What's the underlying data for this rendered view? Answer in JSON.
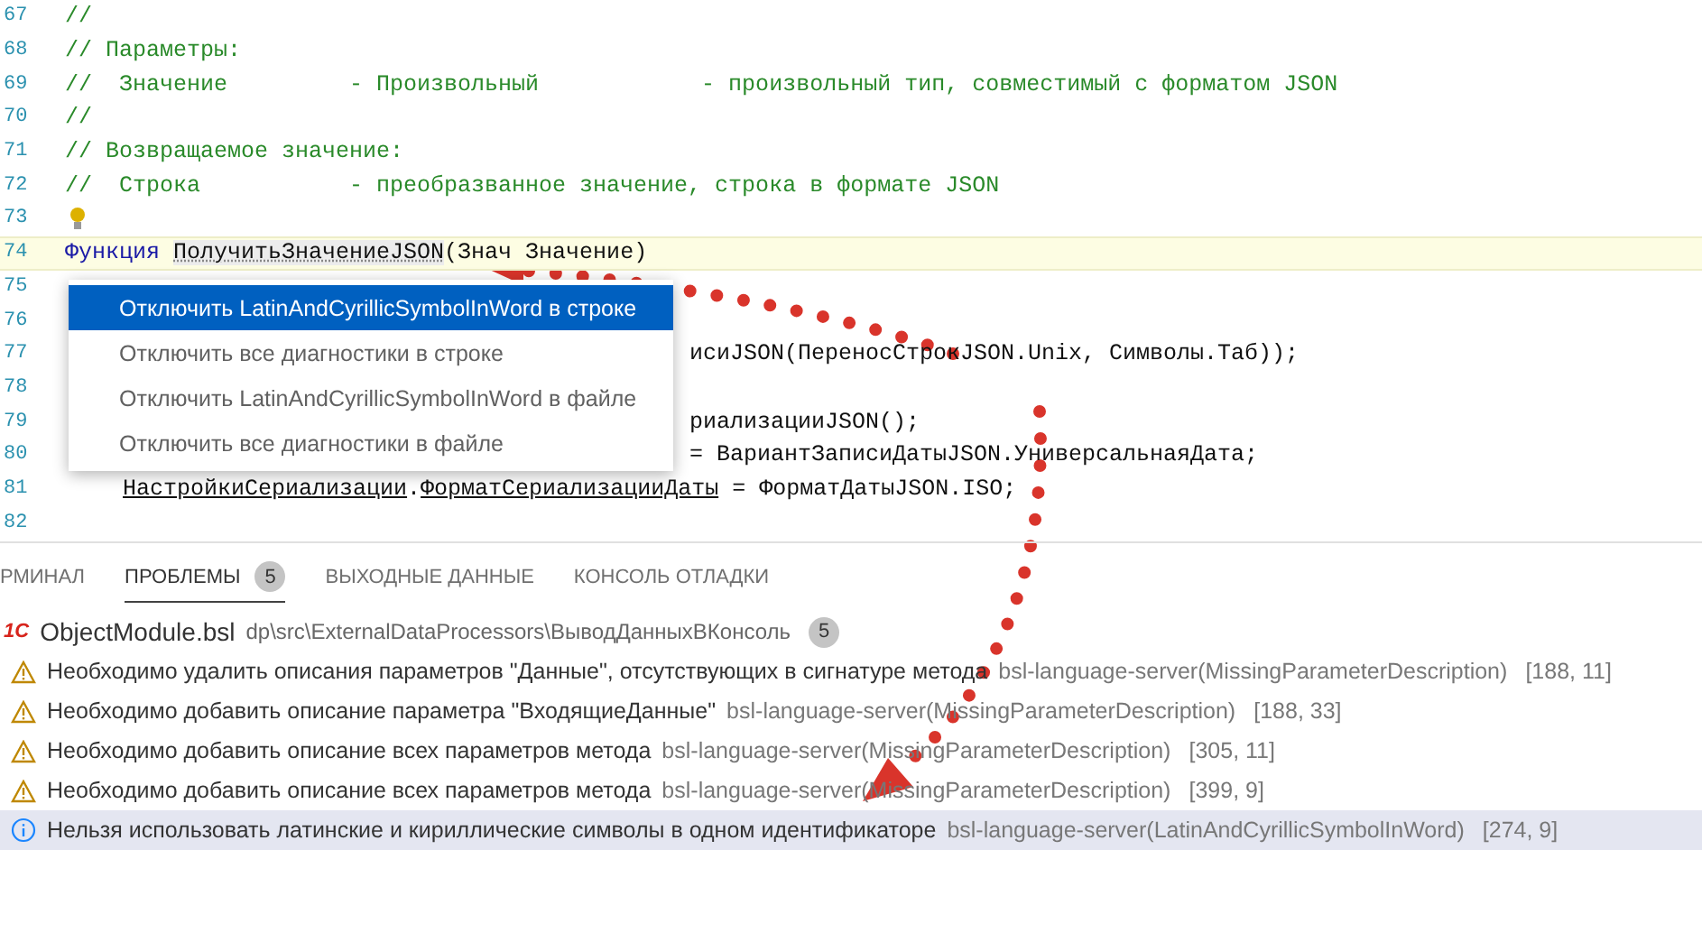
{
  "editor": {
    "lines": [
      {
        "number": "67",
        "segments": [
          {
            "text": "//",
            "kind": "comment"
          }
        ]
      },
      {
        "number": "68",
        "segments": [
          {
            "text": "// Параметры:",
            "kind": "comment"
          }
        ]
      },
      {
        "number": "69",
        "segments": [
          {
            "text": "//  Значение         - Произвольный            - произвольный тип, совместимый с форматом JSON",
            "kind": "comment"
          }
        ]
      },
      {
        "number": "70",
        "segments": [
          {
            "text": "//",
            "kind": "comment"
          }
        ]
      },
      {
        "number": "71",
        "segments": [
          {
            "text": "// Возвращаемое значение:",
            "kind": "comment"
          }
        ]
      },
      {
        "number": "72",
        "segments": [
          {
            "text": "//  Строка           - преобразванное значение, строка в формате JSON",
            "kind": "comment"
          }
        ]
      },
      {
        "number": "73",
        "lightbulb": true
      },
      {
        "number": "74",
        "current": true,
        "segments": [
          {
            "text": "Функция",
            "kind": "keyword"
          },
          {
            "text": "ПолучитьЗначениеJSON",
            "kind": "diagnostic"
          },
          {
            "text": "(Знач Значение)",
            "kind": "plain",
            "joined": true
          }
        ]
      },
      {
        "number": "75"
      },
      {
        "number": "76"
      },
      {
        "number": "77",
        "behind_menu": true,
        "segments": [
          {
            "text": "исиJSON(ПереносСтрокJSON.Unix, Символы.Таб));",
            "kind": "plain"
          }
        ]
      },
      {
        "number": "78"
      },
      {
        "number": "79",
        "behind_menu": true,
        "segments": [
          {
            "text": "риализацииJSON();",
            "kind": "plain"
          }
        ]
      },
      {
        "number": "80",
        "behind_menu": true,
        "segments": [
          {
            "text": "= ВариантЗаписиДатыJSON.УниверсальнаяДата;",
            "kind": "plain"
          }
        ]
      },
      {
        "number": "81",
        "indented": true,
        "segments": [
          {
            "text": "НастройкиСериализации",
            "kind": "underlined"
          },
          {
            "text": ".",
            "kind": "plain",
            "joined": true
          },
          {
            "text": "ФорматСериализацииДаты",
            "kind": "underlined",
            "joined": true
          },
          {
            "text": "= ФорматДатыJSON.ISO;",
            "kind": "plain"
          }
        ]
      },
      {
        "number": "82"
      }
    ]
  },
  "quick_fix_menu": [
    {
      "label": "Отключить LatinAndCyrillicSymbolInWord в строке",
      "selected": true
    },
    {
      "label": "Отключить все диагностики в строке",
      "selected": false
    },
    {
      "label": "Отключить LatinAndCyrillicSymbolInWord в файле",
      "selected": false
    },
    {
      "label": "Отключить все диагностики в файле",
      "selected": false
    }
  ],
  "panel": {
    "tabs": [
      {
        "label": "РМИНАЛ",
        "selected": false
      },
      {
        "label": "ПРОБЛЕМЫ",
        "selected": true,
        "badge": "5"
      },
      {
        "label": "ВЫХОДНЫЕ ДАННЫЕ",
        "selected": false
      },
      {
        "label": "КОНСОЛЬ ОТЛАДКИ",
        "selected": false
      }
    ],
    "file": {
      "logo": "1С",
      "name": "ObjectModule.bsl",
      "path": "dp\\src\\ExternalDataProcessors\\ВыводДанныхВКонсоль",
      "count": "5"
    },
    "problems": [
      {
        "kind": "warning",
        "message": "Необходимо удалить описания параметров \"Данные\", отсутствующих в сигнатуре метода",
        "source": "bsl-language-server(MissingParameterDescription)",
        "position": "[188, 11]",
        "selected": false
      },
      {
        "kind": "warning",
        "message": "Необходимо добавить описание параметра \"ВходящиеДанные\"",
        "source": "bsl-language-server(MissingParameterDescription)",
        "position": "[188, 33]",
        "selected": false
      },
      {
        "kind": "warning",
        "message": "Необходимо добавить описание всех параметров метода",
        "source": "bsl-language-server(MissingParameterDescription)",
        "position": "[305, 11]",
        "selected": false
      },
      {
        "kind": "warning",
        "message": "Необходимо добавить описание всех параметров метода",
        "source": "bsl-language-server(MissingParameterDescription)",
        "position": "[399, 9]",
        "selected": false
      },
      {
        "kind": "info",
        "message": "Нельзя использовать латинские и кириллические символы в одном идентификаторе",
        "source": "bsl-language-server(LatinAndCyrillicSymbolInWord)",
        "position": "[274, 9]",
        "selected": true
      }
    ]
  }
}
